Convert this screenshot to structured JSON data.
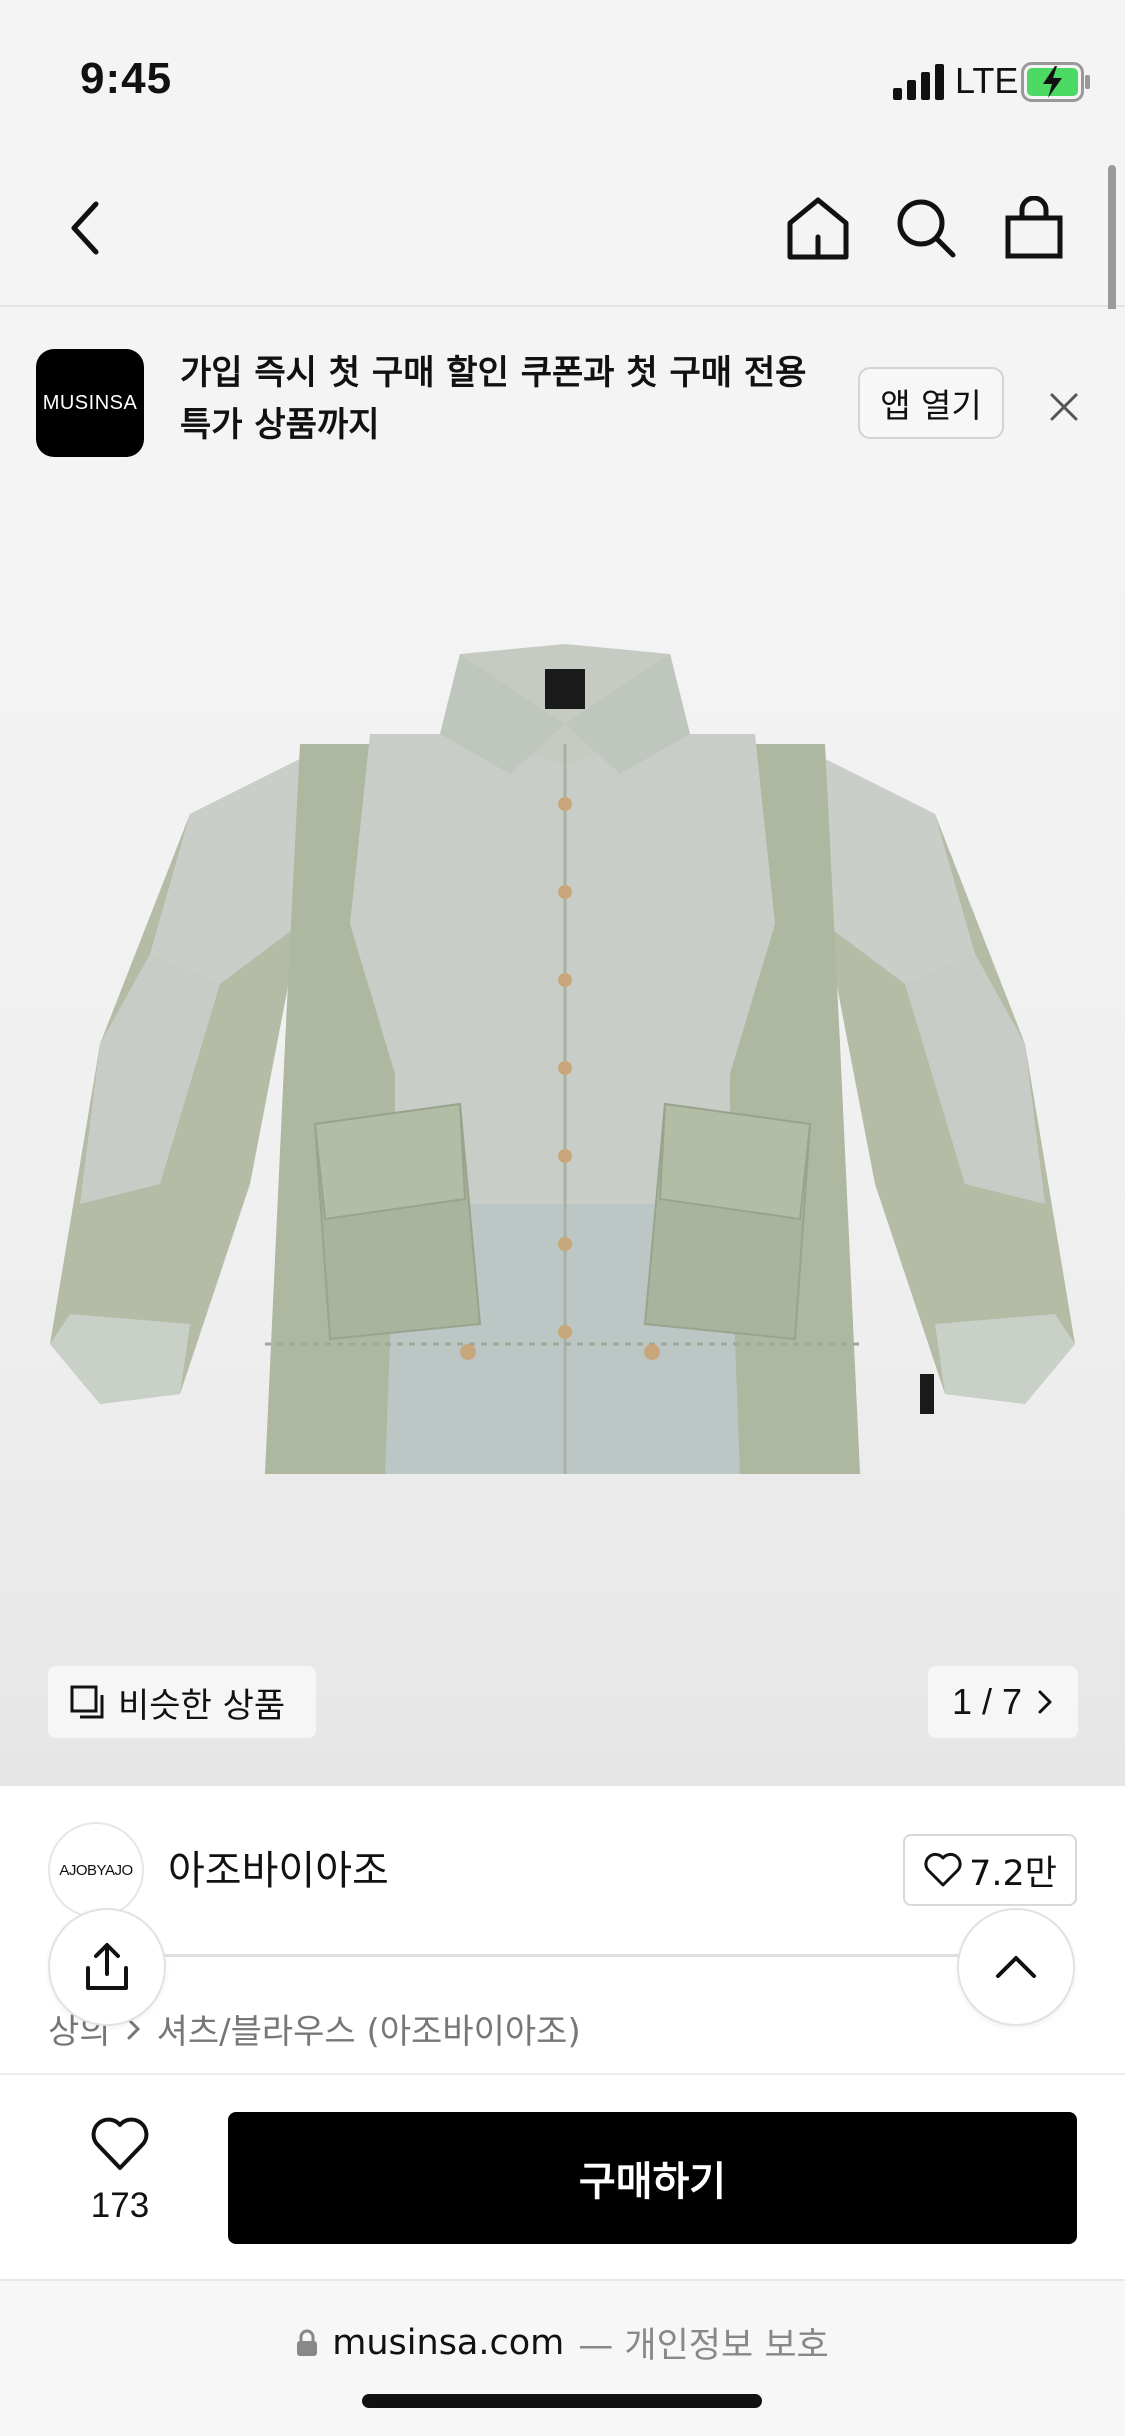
{
  "status_bar": {
    "time": "9:45",
    "network": "LTE"
  },
  "nav": {
    "icons": [
      "chevron-left-icon",
      "home-icon",
      "search-icon",
      "shopping-bag-icon"
    ]
  },
  "promo": {
    "logo_text": "MUSINSA",
    "message": "가입 즉시 첫 구매 할인 쿠폰과 첫 구매 전용 특가 상품까지",
    "open_app_label": "앱 열기"
  },
  "gallery": {
    "similar_label": "비슷한 상품",
    "page_indicator": "1 / 7",
    "image_colors": {
      "light_panel": "#c6cdc6",
      "sage_panel": "#aeb79f",
      "pale_blue_panel": "#bcc6c4",
      "buttons": "#c9a77c"
    }
  },
  "brand": {
    "avatar_text": "AJOBYAJO",
    "name": "아조바이아조",
    "like_count": "7.2만"
  },
  "breadcrumb": {
    "items": [
      "상의",
      "셔츠/블라우스 (아조바이아조)"
    ]
  },
  "purchase": {
    "wish_count": "173",
    "buy_label": "구매하기",
    "accent": "#000000"
  },
  "browser": {
    "domain": "musinsa.com",
    "secure_label": "— 개인정보 보호"
  }
}
